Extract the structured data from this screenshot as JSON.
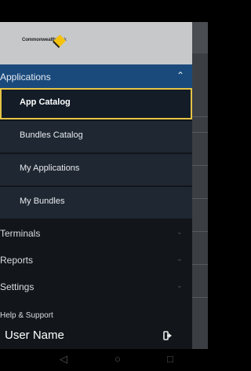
{
  "brand": {
    "logo_text_bold": "Commonwealth",
    "logo_text_light": "Bank"
  },
  "nav": {
    "applications": {
      "label": "Applications",
      "expanded": true,
      "items": [
        {
          "label": "App Catalog",
          "active": true
        },
        {
          "label": "Bundles Catalog",
          "active": false
        },
        {
          "label": "My Applications",
          "active": false
        },
        {
          "label": "My Bundles",
          "active": false
        }
      ]
    },
    "sections": [
      {
        "label": "Terminals"
      },
      {
        "label": "Reports"
      },
      {
        "label": "Settings"
      }
    ],
    "help_label": "Help & Support"
  },
  "user": {
    "name": "User Name"
  },
  "colors": {
    "accent": "#1a4a7c",
    "active_border": "#e5c445",
    "drawer_bg": "#12161b"
  }
}
